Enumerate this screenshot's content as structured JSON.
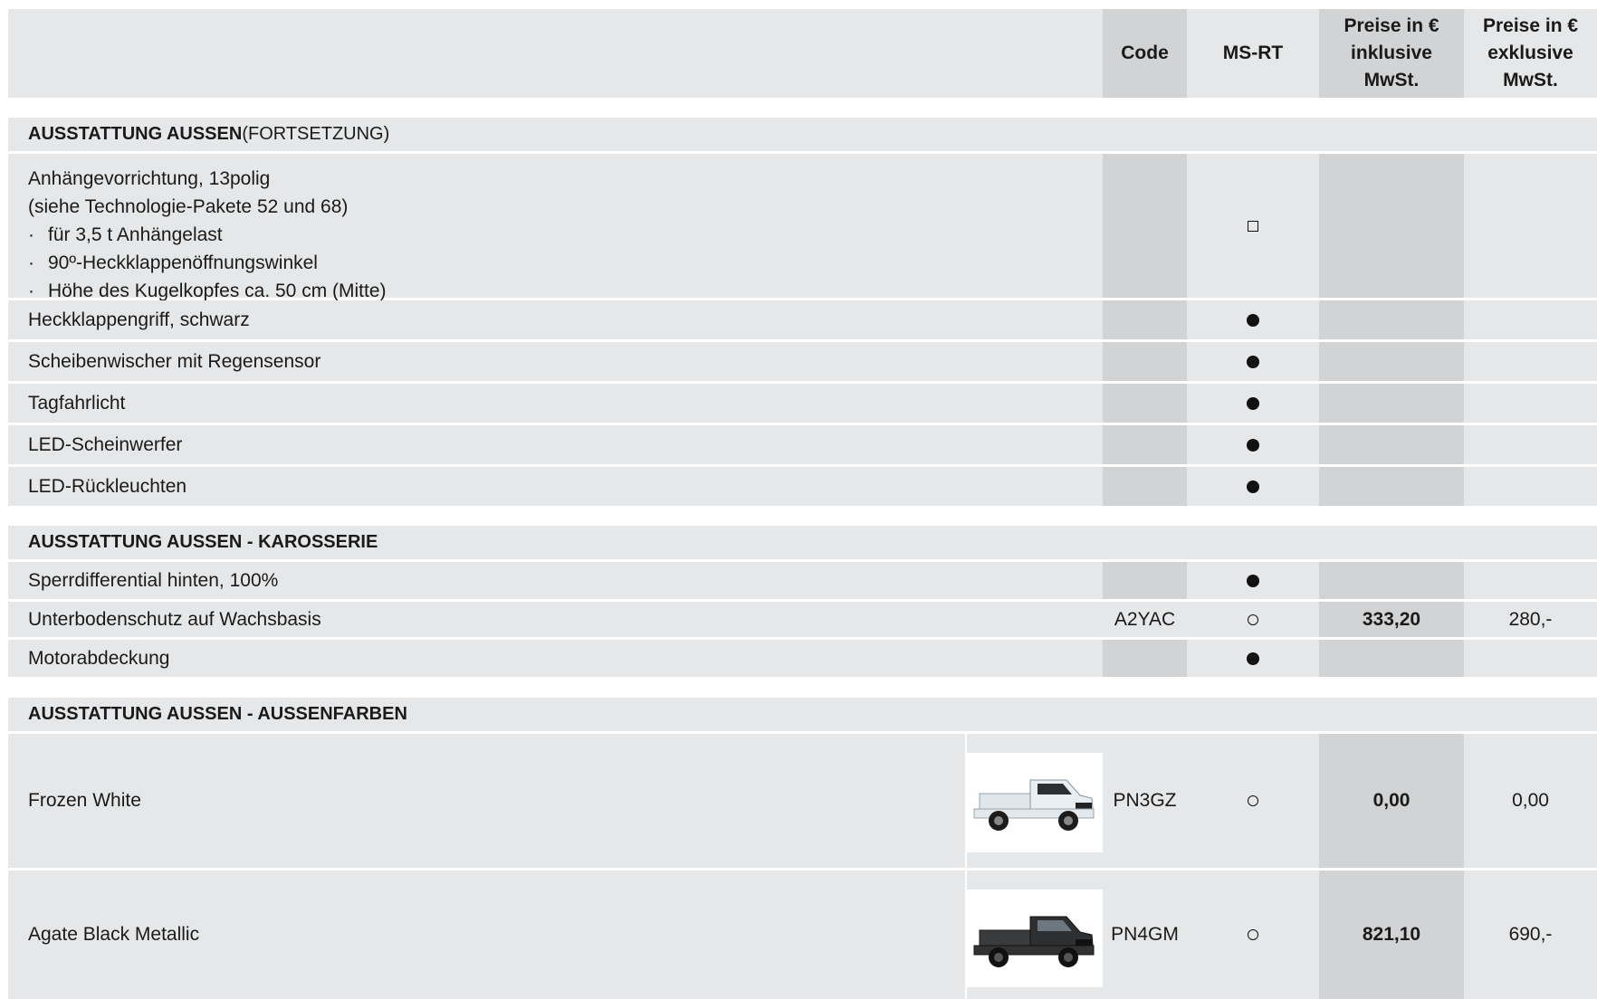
{
  "header": {
    "code": "Code",
    "msrt": "MS-RT",
    "incl": [
      "Preise in €",
      "inklusive",
      "MwSt."
    ],
    "excl": [
      "Preise in €",
      "exklusive",
      "MwSt."
    ]
  },
  "sections": {
    "s1": {
      "bold": "AUSSTATTUNG AUSSEN",
      "normal": " (FORTSETZUNG)"
    },
    "s2": {
      "bold": "AUSSTATTUNG AUSSEN - KAROSSERIE"
    },
    "s3": {
      "bold": "AUSSTATTUNG AUSSEN - AUSSENFARBEN"
    }
  },
  "rows": {
    "anh": {
      "lines": [
        "Anhängevorrichtung, 13polig",
        "(siehe Technologie-Pakete 52 und 68)"
      ],
      "bullets": [
        "für 3,5 t Anhängelast",
        "90º-Heckklappenöffnungswinkel",
        "Höhe des Kugelkopfes ca. 50 cm (Mitte)"
      ],
      "bullet_char": "·"
    },
    "heck": {
      "label": "Heckklappengriff, schwarz"
    },
    "scheib": {
      "label": "Scheibenwischer mit Regensensor"
    },
    "tag": {
      "label": "Tagfahrlicht"
    },
    "led1": {
      "label": "LED-Scheinwerfer"
    },
    "led2": {
      "label": "LED-Rückleuchten"
    },
    "sperr": {
      "label": "Sperrdifferential hinten, 100%"
    },
    "unter": {
      "label": "Unterbodenschutz auf Wachsbasis",
      "code": "A2YAC",
      "incl": "333,20",
      "excl": "280,-"
    },
    "motor": {
      "label": "Motorabdeckung"
    },
    "frozen": {
      "label": "Frozen White",
      "code": "PN3GZ",
      "incl": "0,00",
      "excl": "0,00",
      "car_color": "#e9eef2"
    },
    "agate": {
      "label": "Agate Black Metallic",
      "code": "PN4GM",
      "incl": "821,10",
      "excl": "690,-",
      "car_color": "#2e2f31"
    }
  },
  "legend": {
    "standard": "filled-circle-icon",
    "option": "open-circle-icon",
    "package": "square-icon"
  }
}
